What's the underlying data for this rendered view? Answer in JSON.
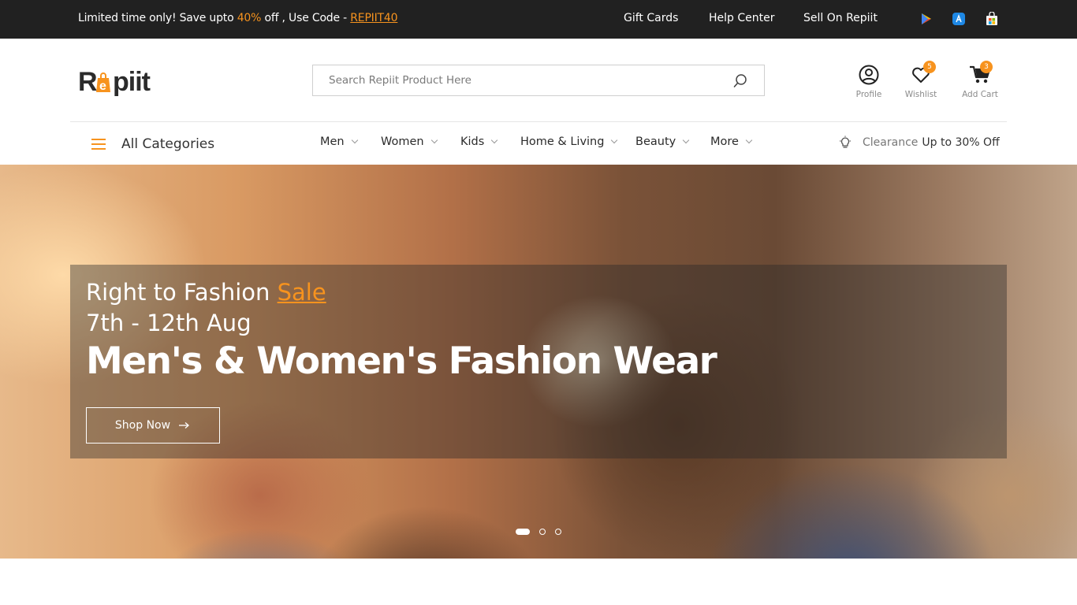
{
  "topbar": {
    "promo_prefix": "Limited time only! Save upto ",
    "promo_percent": "40%",
    "promo_middle": " off , Use Code - ",
    "promo_code": "REPIIT40",
    "links": [
      "Gift Cards",
      "Help Center",
      "Sell On Repiit"
    ],
    "store_icons": [
      "google-play-icon",
      "app-store-icon",
      "microsoft-store-icon"
    ]
  },
  "header": {
    "logo_text": "Repiit",
    "search_placeholder": "Search Repiit Product Here",
    "profile_label": "Profile",
    "wishlist_label": "Wishlist",
    "wishlist_count": "5",
    "cart_label": "Add Cart",
    "cart_count": "3"
  },
  "nav": {
    "all_categories": "All Categories",
    "items": [
      "Men",
      "Women",
      "Kids",
      "Home & Living",
      "Beauty",
      "More"
    ],
    "clearance_label": "Clearance",
    "clearance_deal": "Up to 30% Off"
  },
  "hero": {
    "line1_prefix": "Right to Fashion ",
    "line1_highlight": "Sale",
    "line2": "7th - 12th Aug",
    "headline": "Men's & Women's Fashion Wear",
    "button_label": "Shop Now",
    "slides": 3,
    "active_slide": 1
  },
  "colors": {
    "accent": "#f7931e",
    "topbar_bg": "#212121"
  }
}
